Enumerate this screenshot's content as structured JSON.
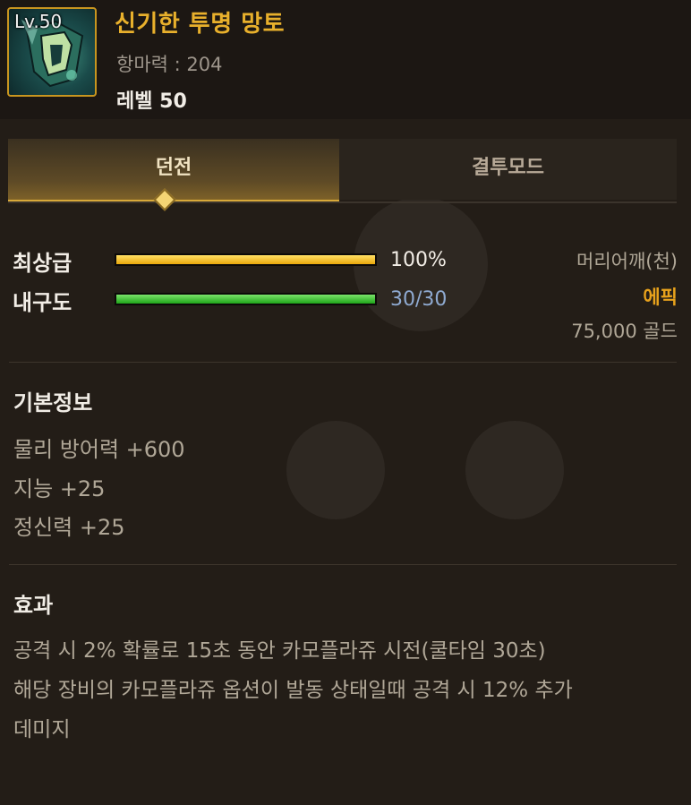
{
  "item": {
    "level_badge": "Lv.50",
    "name": "신기한 투명 망토",
    "power": "항마력 : 204",
    "level": "레벨 50"
  },
  "tabs": [
    {
      "label": "던전",
      "active": true
    },
    {
      "label": "결투모드",
      "active": false
    }
  ],
  "stats_bars": [
    {
      "label": "최상급",
      "value_text": "100%",
      "fraction": 1.0,
      "color": "#f0b820"
    },
    {
      "label": "내구도",
      "value_text": "30/30",
      "fraction": 1.0,
      "color": "#2fbf2a"
    }
  ],
  "meta": {
    "slot": "머리어깨(천)",
    "rarity": "에픽",
    "price": "75,000 골드",
    "rarity_color": "#e8a21c"
  },
  "basic_info": {
    "title": "기본정보",
    "lines": [
      "물리 방어력 +600",
      "지능 +25",
      "정신력 +25"
    ]
  },
  "effect": {
    "title": "효과",
    "lines": [
      "공격 시 2% 확률로 15초 동안 카모플라쥬 시전(쿨타임 30초)",
      "해당 장비의 카모플라쥬 옵션이 발동 상태일때 공격 시 12% 추가",
      "데미지"
    ]
  },
  "colors": {
    "accent_gold": "#e8b02c",
    "background": "#231d17"
  },
  "icons": {
    "item": "cloak-item-icon",
    "tab_indicator": "diamond-indicator-icon"
  }
}
